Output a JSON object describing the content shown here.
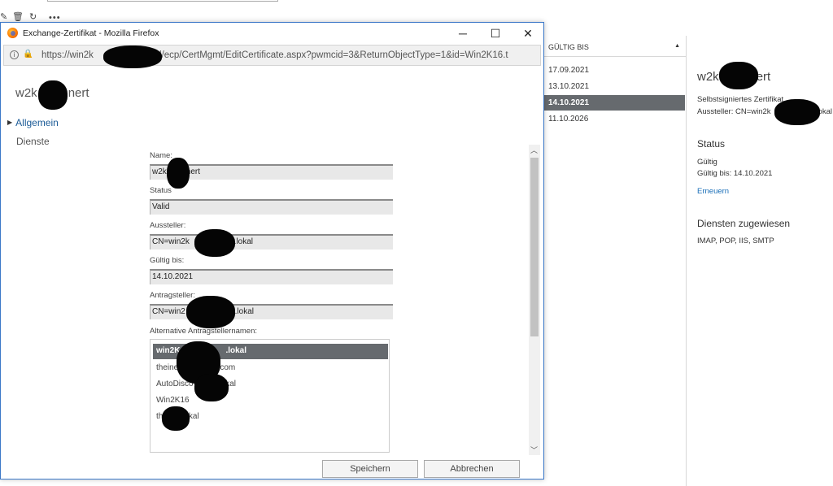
{
  "background": {
    "list_column_header": "GÜLTIG BIS",
    "sort_glyph": "▲",
    "dates": [
      "17.09.2021",
      "13.10.2021",
      "14.10.2021",
      "11.10.2026"
    ],
    "selected_index": 2,
    "detail": {
      "title_start": "w2k",
      "title_end": "ert",
      "cert_type": "Selbstsigniertes Zertifikat",
      "issuer_start": "Aussteller: CN=win2k",
      "issuer_end": "okal",
      "status_heading": "Status",
      "status_value": "Gültig",
      "valid_until": "Gültig bis: 14.10.2021",
      "renew_link": "Erneuern",
      "services_heading": "Diensten zugewiesen",
      "services_value": "IMAP, POP, IIS, SMTP"
    },
    "toolbar_icons": [
      "pencil-icon",
      "trash-icon",
      "refresh-icon",
      "more-icon"
    ]
  },
  "window": {
    "title": "Exchange-Zertifikat - Mozilla Firefox",
    "minimize": "─",
    "maximize": "☐",
    "close": "✕",
    "url_start": "https://win2k",
    "url_end": "lokal/ecp/CertMgmt/EditCertificate.aspx?pwmcid=3&ReturnObjectType=1&id=Win2K16.t"
  },
  "page": {
    "title_start": "w2k",
    "title_end": "nert",
    "nav": {
      "general": "Allgemein",
      "services": "Dienste"
    },
    "fields": {
      "name_label": "Name:",
      "name_value_start": "w2k",
      "name_value_end": "nert",
      "status_label": "Status",
      "status_value": "Valid",
      "issuer_label": "Aussteller:",
      "issuer_value_start": "CN=win2k",
      "issuer_value_end": "t.lokal",
      "valid_label": "Gültig bis:",
      "valid_value": "14.10.2021",
      "requester_label": "Antragsteller:",
      "requester_value_start": "CN=win2",
      "requester_value_end": "t.lokal",
      "alt_label": "Alternative Antragstellernamen:"
    },
    "alt_names": [
      {
        "start": "win2K",
        "end": ".lokal"
      },
      {
        "start": "theine",
        "end": "er.com"
      },
      {
        "start": "AutoDiscov",
        "end": "rt.lokal"
      },
      {
        "start": "Win2K16",
        "end": ""
      },
      {
        "start": "th",
        "end": "okal"
      }
    ],
    "buttons": {
      "save": "Speichern",
      "cancel": "Abbrechen"
    }
  }
}
